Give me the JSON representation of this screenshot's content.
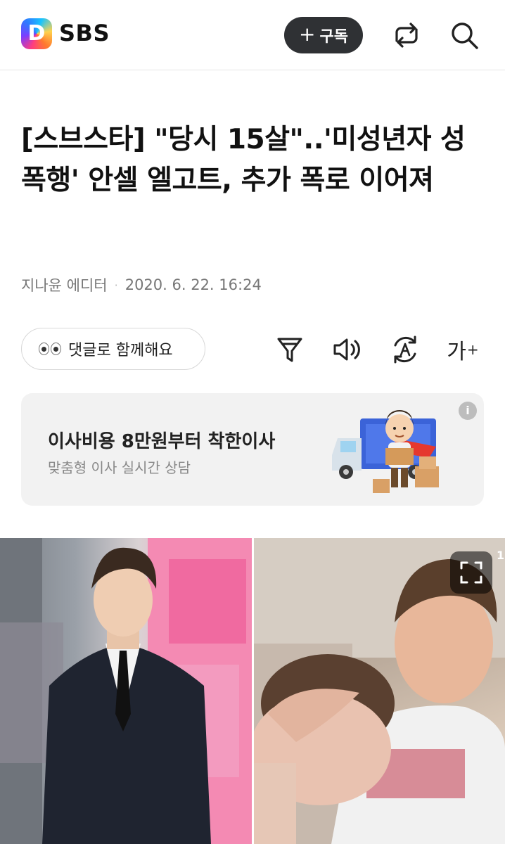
{
  "header": {
    "logo_letter": "D",
    "brand": "SBS",
    "subscribe_plus": "+",
    "subscribe_label": "구독",
    "icons": [
      "share-icon",
      "search-icon"
    ]
  },
  "article": {
    "headline": "[스브스타] \"당시 15살\"..'미성년자 성폭행' 안셀 엘고트, 추가 폭로 이어져",
    "author": "지나윤 에디터",
    "meta_dot": "·",
    "date": "2020. 6. 22. 16:24"
  },
  "tools": {
    "comment_label": "댓글로 함께해요",
    "font_label": "가",
    "font_plus": "+",
    "icons": [
      "filter-icon",
      "speaker-icon",
      "translate-icon",
      "font-size-icon"
    ]
  },
  "ad": {
    "title": "이사비용 8만원부터 착한이사",
    "subtitle": "맞춤형 이사 실시간 상담",
    "info_glyph": "i"
  },
  "photo": {
    "counter": "1"
  },
  "colors": {
    "subscribe_bg": "#2f3134",
    "ad_bg": "#f2f2f2",
    "meta_text": "#777777"
  }
}
